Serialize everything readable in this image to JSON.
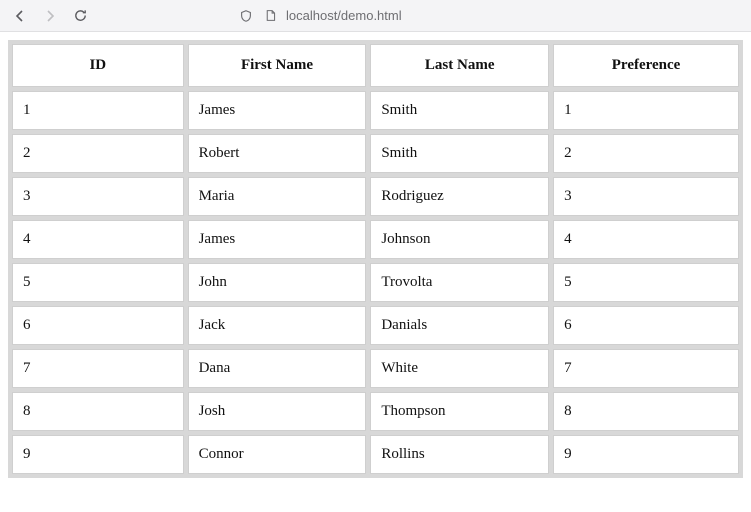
{
  "browser": {
    "url": "localhost/demo.html"
  },
  "table": {
    "headers": [
      "ID",
      "First Name",
      "Last Name",
      "Preference"
    ],
    "rows": [
      {
        "id": "1",
        "first": "James",
        "last": "Smith",
        "pref": "1"
      },
      {
        "id": "2",
        "first": "Robert",
        "last": "Smith",
        "pref": "2"
      },
      {
        "id": "3",
        "first": "Maria",
        "last": "Rodriguez",
        "pref": "3"
      },
      {
        "id": "4",
        "first": "James",
        "last": "Johnson",
        "pref": "4"
      },
      {
        "id": "5",
        "first": "John",
        "last": "Trovolta",
        "pref": "5"
      },
      {
        "id": "6",
        "first": "Jack",
        "last": "Danials",
        "pref": "6"
      },
      {
        "id": "7",
        "first": "Dana",
        "last": "White",
        "pref": "7"
      },
      {
        "id": "8",
        "first": "Josh",
        "last": "Thompson",
        "pref": "8"
      },
      {
        "id": "9",
        "first": "Connor",
        "last": "Rollins",
        "pref": "9"
      }
    ]
  }
}
